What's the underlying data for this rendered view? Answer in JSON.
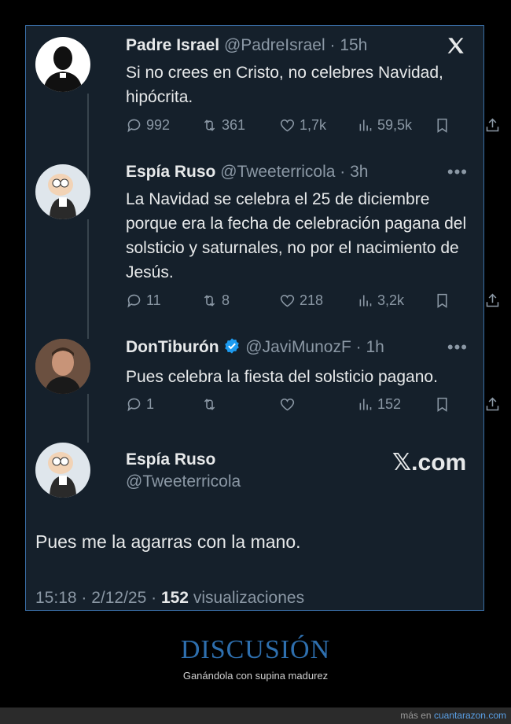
{
  "tweets": [
    {
      "name": "Padre Israel",
      "handle": "@PadreIsrael",
      "sep": " · ",
      "time": "15h",
      "text": "Si no crees en Cristo, no celebres Navidad, hipócrita.",
      "replies": "992",
      "retweets": "361",
      "likes": "1,7k",
      "views": "59,5k"
    },
    {
      "name": "Espía Ruso",
      "handle": "@Tweeterricola",
      "sep": " · ",
      "time": "3h",
      "text": "La Navidad se celebra el 25 de diciembre porque era la fecha de celebración pagana del solsticio y saturnales, no por el nacimiento de Jesús.",
      "replies": "11",
      "retweets": "8",
      "likes": "218",
      "views": "3,2k"
    },
    {
      "name": "DonTiburón",
      "handle": "@JaviMunozF",
      "sep": " · ",
      "time": "1h",
      "text": "Pues celebra la fiesta del solsticio pagano.",
      "replies": "1",
      "retweets": "",
      "likes": "",
      "views": "152"
    }
  ],
  "main": {
    "name": "Espía Ruso",
    "handle": "@Tweeterricola",
    "brand": "𝕏.com",
    "text": "Pues me la agarras con la mano.",
    "datetime": "15:18 · 2/12/25 · ",
    "views_count": "152",
    "views_label": " visualizaciones"
  },
  "footer": {
    "title": "DISCUSIÓN",
    "subtitle": "Ganándola con supina madurez",
    "credit_prefix": "más en ",
    "credit_site": "cuantarazon.com"
  },
  "icons": [
    "x-logo-icon",
    "reply-icon",
    "retweet-icon",
    "like-icon",
    "views-icon",
    "bookmark-icon",
    "share-icon",
    "more-icon",
    "verified-icon"
  ],
  "colors": {
    "card_bg": "#15202b",
    "muted": "#8b98a5",
    "text": "#e7e9ea",
    "verified": "#1d9bf0",
    "footer_title": "#2e6fae"
  }
}
